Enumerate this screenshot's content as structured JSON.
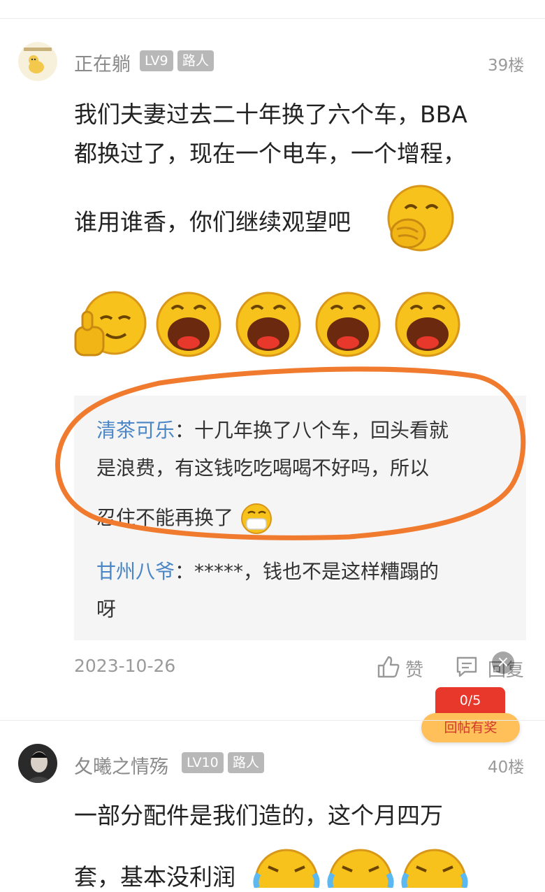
{
  "posts": [
    {
      "user": "正在躺",
      "level": "LV9",
      "role": "路人",
      "floor": "39楼",
      "lines": [
        "我们夫妻过去二十年换了六个车，BBA",
        "都换过了，现在一个电车，一个增程，",
        "谁用谁香，你们继续观望吧"
      ],
      "replies": [
        {
          "user": "清茶可乐",
          "sep": "：",
          "lines": [
            "十几年换了八个车，回头看就",
            "是浪费，有这钱吃吃喝喝不好吗，所以",
            "忍住不能再换了"
          ]
        },
        {
          "user": "甘州八爷",
          "sep": "：",
          "lines": [
            "*****，钱也不是这样糟蹋的",
            "呀"
          ]
        }
      ],
      "date": "2023-10-26",
      "like_label": "赞",
      "reply_label": "回复"
    },
    {
      "user": "夂曦之情殇",
      "level": "LV10",
      "role": "路人",
      "floor": "40楼",
      "lines": [
        "一部分配件是我们造的，这个月四万",
        "套，基本没利润"
      ]
    }
  ],
  "reward_badge": {
    "count": "0/5",
    "label": "回帖有奖",
    "close": "×"
  },
  "colors": {
    "username_link": "#4a86c6",
    "highlight_circle": "#f07a2e",
    "badge_red": "#e8372b",
    "badge_orange": "#ffc05a"
  }
}
